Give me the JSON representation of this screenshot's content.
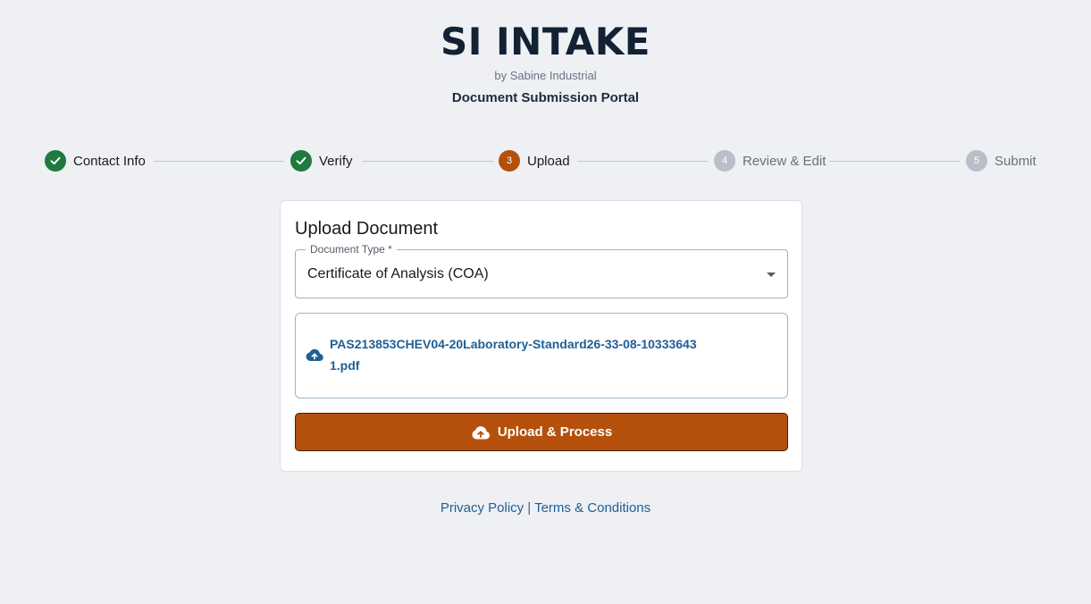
{
  "header": {
    "brand": "SI INTAKE",
    "byline": "by Sabine Industrial",
    "portal_title": "Document Submission Portal"
  },
  "stepper": {
    "steps": [
      {
        "number": "1",
        "label": "Contact Info",
        "state": "done"
      },
      {
        "number": "2",
        "label": "Verify",
        "state": "done"
      },
      {
        "number": "3",
        "label": "Upload",
        "state": "active"
      },
      {
        "number": "4",
        "label": "Review & Edit",
        "state": "pending"
      },
      {
        "number": "5",
        "label": "Submit",
        "state": "pending"
      }
    ]
  },
  "upload_card": {
    "title": "Upload Document",
    "document_type_label": "Document Type *",
    "document_type_value": "Certificate of Analysis (COA)",
    "file_name": "PAS213853CHEV04-20Laboratory-Standard26-33-08-103336431.pdf",
    "upload_button_label": "Upload & Process"
  },
  "footer": {
    "privacy_link": "Privacy Policy",
    "separator": "|",
    "terms_link": "Terms & Conditions"
  },
  "colors": {
    "brand_navy": "#122234",
    "done_green": "#1f7a3e",
    "active_orange": "#b5500c",
    "pending_gray": "#b9bec8",
    "link_blue": "#1f5f94",
    "page_background": "#eef0f4"
  },
  "icons": {
    "done_step": "check-icon",
    "file": "cloud-upload-icon",
    "button": "cloud-upload-icon",
    "select": "caret-down-icon"
  }
}
